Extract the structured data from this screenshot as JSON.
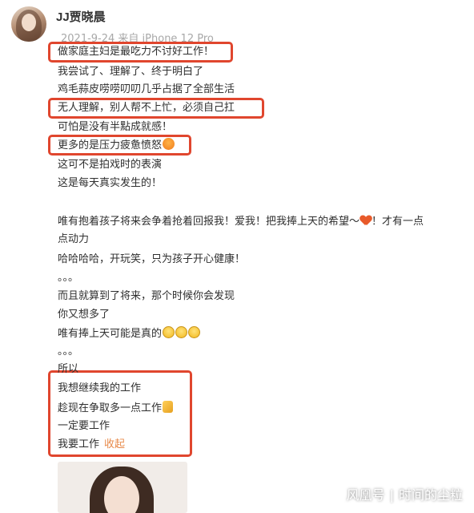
{
  "post": {
    "username": "JJ贾晓晨",
    "meta": "2021-9-24 来自 iPhone 12 Pro",
    "lines": [
      "做家庭主妇是最吃力不讨好工作！",
      "我尝试了、理解了、终于明白了",
      "鸡毛蒜皮唠唠叨叨几乎占据了全部生活",
      "无人理解，别人帮不上忙，必须自己扛",
      "可怕是没有半點成就感！",
      "更多的是压力疲惫愤怒",
      "这可不是拍戏时的表演",
      "这是每天真实发生的！",
      "唯有抱着孩子将来会争着抢着回报我！爱我！把我捧上天的希望～",
      "！才有一点",
      "点动力",
      "哈哈哈哈，开玩笑，只为孩子开心健康！",
      "。。。",
      "而且就算到了将来，那个时候你会发现",
      "你又想多了",
      "唯有捧上天可能是真的",
      "。。。",
      "所以",
      "我想继续我的工作",
      "趁现在争取多一点工作",
      "一定要工作",
      "我要工作"
    ],
    "collapse_label": "收起"
  },
  "icons": {
    "angry": "angry-face-icon",
    "heart": "heart-icon",
    "laugh": "laughing-face-icon",
    "muscle": "flexed-biceps-icon"
  },
  "colors": {
    "highlight": "#e0462e",
    "collapse": "#e88a4a",
    "meta": "#a8a8a8"
  },
  "watermark": {
    "platform": "风凰号",
    "separator": "|",
    "author": "时间的尘粒"
  }
}
